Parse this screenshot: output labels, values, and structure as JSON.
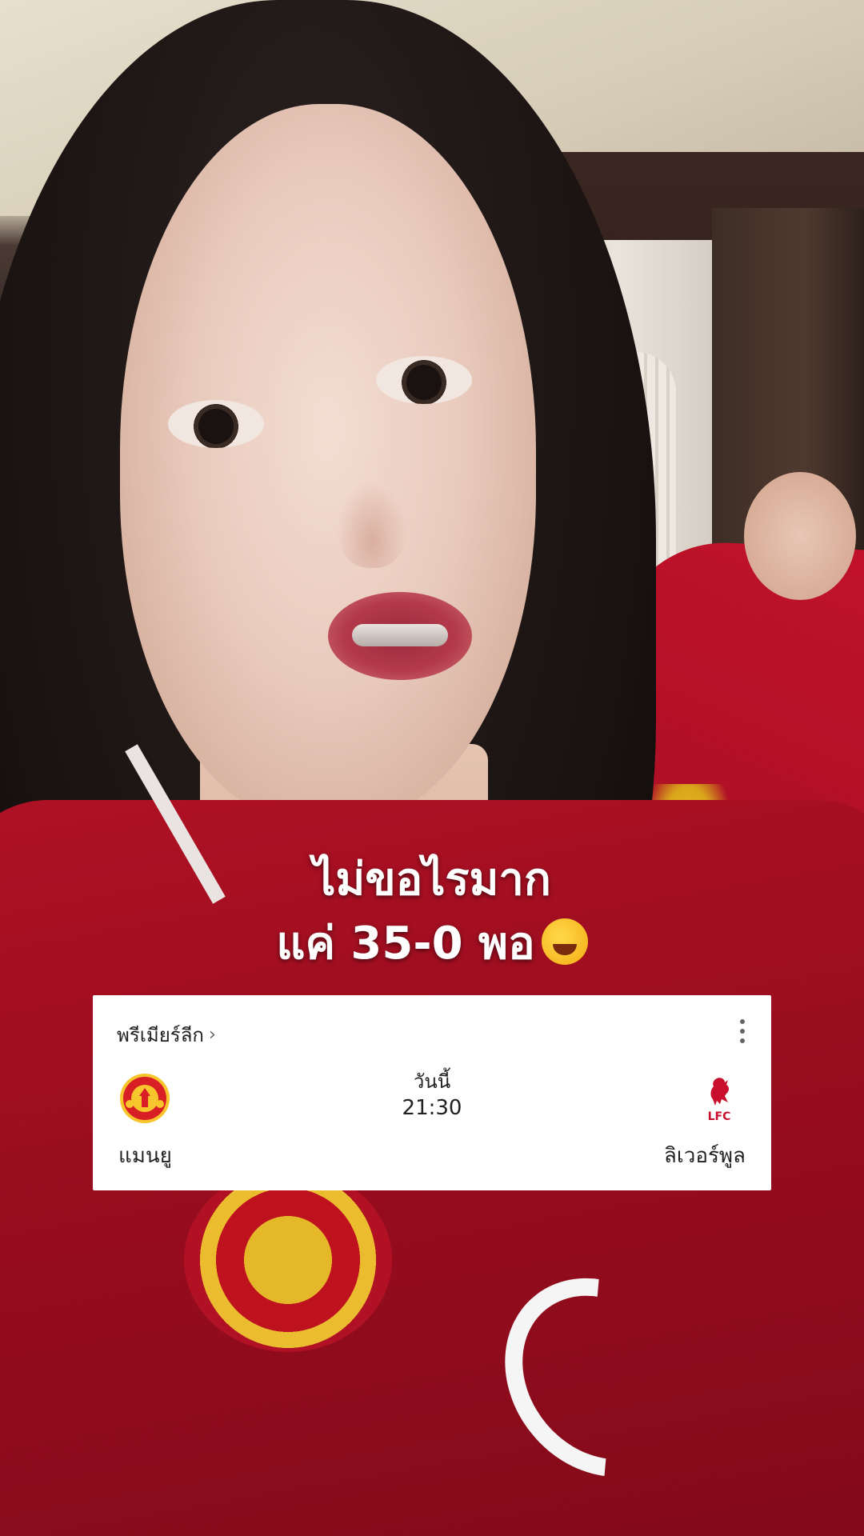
{
  "overlay": {
    "caption_line1": "ไม่ขอไรมาก",
    "caption_line2": "แค่ 35-0 พอ",
    "caption_emoji": "rolling-on-floor-laughing-emoji"
  },
  "match_card": {
    "league_label": "พรีเมียร์ลีก",
    "league_chevron": "›",
    "more_icon": "more-vertical-icon",
    "day_label": "วันนี้",
    "kickoff_time": "21:30",
    "home_team": {
      "name": "แมนยู",
      "logo": "manchester-united-crest",
      "logo_colors": [
        "#d81f26",
        "#f7c52c"
      ]
    },
    "away_team": {
      "name": "ลิเวอร์พูล",
      "logo": "liverpool-liverbird-crest",
      "logo_text": "LFC",
      "logo_colors": [
        "#c8102e"
      ]
    }
  },
  "colors": {
    "card_background": "#ffffff",
    "card_text": "#202124",
    "caption_text": "#ffffff"
  }
}
